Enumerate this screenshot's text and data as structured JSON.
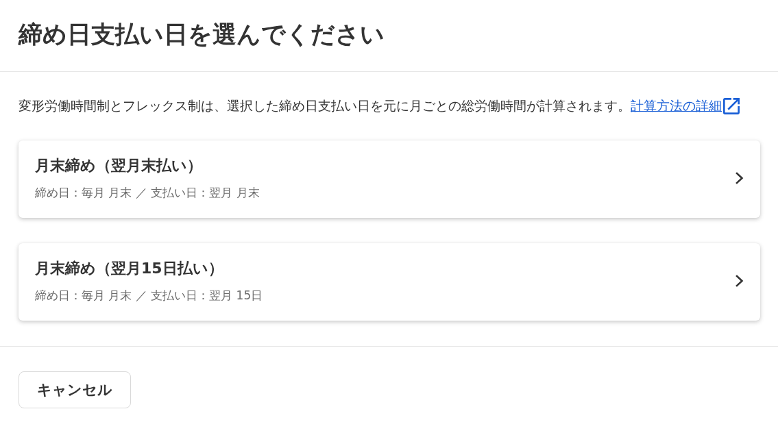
{
  "dialog": {
    "title": "締め日支払い日を選んでください",
    "description": {
      "text": "変形労働時間制とフレックス制は、選択した締め日支払い日を元に月ごとの総労働時間が計算されます。",
      "link": "計算方法の詳細"
    },
    "options": [
      {
        "title": "月末締め（翌月末払い）",
        "detail": "締め日：毎月 月末 ／ 支払い日：翌月 月末"
      },
      {
        "title": "月末締め（翌月15日払い）",
        "detail": "締め日：毎月 月末 ／ 支払い日：翌月 15日"
      }
    ],
    "buttons": [
      {
        "label": "キャンセル"
      }
    ]
  }
}
